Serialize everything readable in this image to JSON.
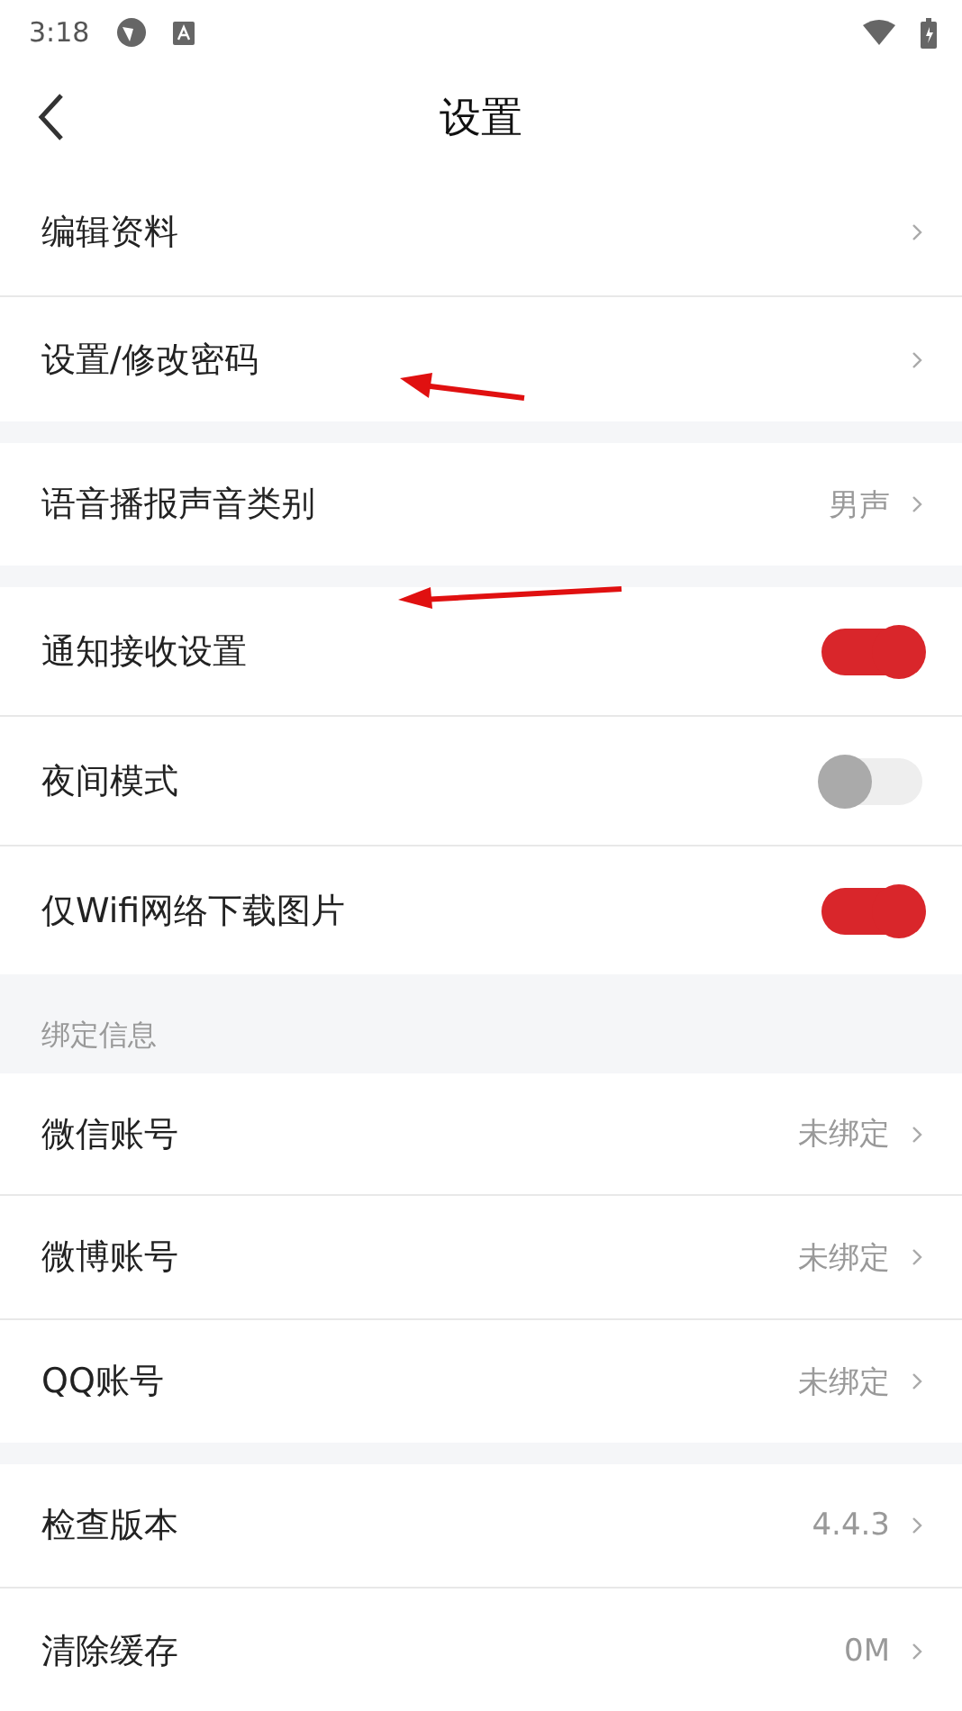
{
  "status_bar": {
    "time": "3:18"
  },
  "header": {
    "title": "设置"
  },
  "groups": [
    {
      "items": [
        {
          "kind": "nav",
          "label": "编辑资料"
        },
        {
          "kind": "nav",
          "label": "设置/修改密码"
        }
      ]
    },
    {
      "items": [
        {
          "kind": "nav",
          "label": "语音播报声音类别",
          "value": "男声"
        }
      ]
    },
    {
      "items": [
        {
          "kind": "toggle",
          "label": "通知接收设置",
          "on": true
        },
        {
          "kind": "toggle",
          "label": "夜间模式",
          "on": false
        },
        {
          "kind": "toggle",
          "label": "仅Wifi网络下载图片",
          "on": true
        }
      ]
    },
    {
      "title": "绑定信息",
      "items": [
        {
          "kind": "nav",
          "label": "微信账号",
          "value": "未绑定"
        },
        {
          "kind": "nav",
          "label": "微博账号",
          "value": "未绑定"
        },
        {
          "kind": "nav",
          "label": "QQ账号",
          "value": "未绑定"
        }
      ]
    },
    {
      "items": [
        {
          "kind": "nav",
          "label": "检查版本",
          "value": "4.4.3"
        },
        {
          "kind": "nav",
          "label": "清除缓存",
          "value": "0M"
        }
      ]
    }
  ]
}
